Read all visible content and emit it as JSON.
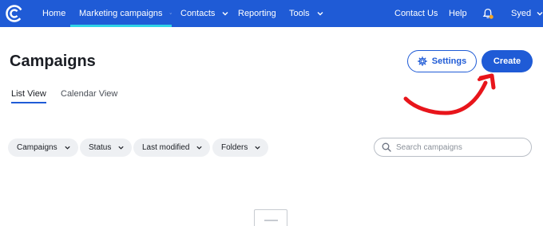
{
  "nav": {
    "items": [
      {
        "label": "Home"
      },
      {
        "label": "Marketing campaigns",
        "active": true
      },
      {
        "label": "Contacts"
      },
      {
        "label": "Reporting"
      },
      {
        "label": "Tools"
      }
    ],
    "right": {
      "contact_us": "Contact Us",
      "help": "Help",
      "user": "Syed"
    },
    "colors": {
      "bar": "#1f5bd6",
      "active_indicator": "#2fd3e6",
      "notification_dot": "#f5a623"
    }
  },
  "header": {
    "title": "Campaigns",
    "settings_label": "Settings",
    "create_label": "Create"
  },
  "tabs": [
    {
      "label": "List View",
      "active": true
    },
    {
      "label": "Calendar View"
    }
  ],
  "filters": [
    {
      "label": "Campaigns"
    },
    {
      "label": "Status"
    },
    {
      "label": "Last modified"
    },
    {
      "label": "Folders"
    }
  ],
  "search": {
    "placeholder": "Search campaigns"
  },
  "annotation": {
    "type": "arrow",
    "color": "#e8151b",
    "points_to": "create-button"
  },
  "icons": {
    "logo": "constant-contact-logo-icon",
    "chevron": "chevron-down-icon",
    "bell": "bell-icon",
    "gear": "gear-icon",
    "search": "search-icon"
  }
}
